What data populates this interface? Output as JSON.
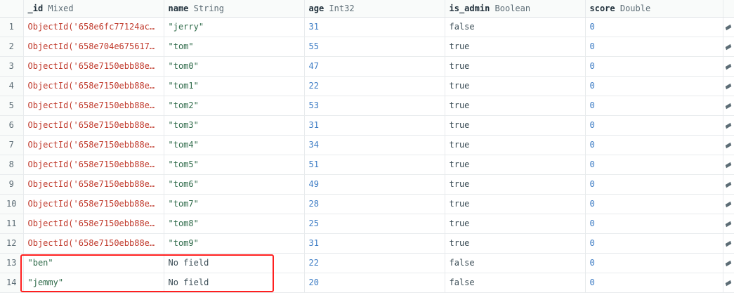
{
  "columns": [
    {
      "name": "_id",
      "type": "Mixed"
    },
    {
      "name": "name",
      "type": "String"
    },
    {
      "name": "age",
      "type": "Int32"
    },
    {
      "name": "is_admin",
      "type": "Boolean"
    },
    {
      "name": "score",
      "type": "Double"
    }
  ],
  "rows": [
    {
      "num": "1",
      "id": "ObjectId('658e6fc77124ac…",
      "id_kind": "oid",
      "name": "\"jerry\"",
      "name_kind": "str",
      "age": "31",
      "is_admin": "false",
      "score": "0"
    },
    {
      "num": "2",
      "id": "ObjectId('658e704e675617…",
      "id_kind": "oid",
      "name": "\"tom\"",
      "name_kind": "str",
      "age": "55",
      "is_admin": "true",
      "score": "0"
    },
    {
      "num": "3",
      "id": "ObjectId('658e7150ebb88e…",
      "id_kind": "oid",
      "name": "\"tom0\"",
      "name_kind": "str",
      "age": "47",
      "is_admin": "true",
      "score": "0"
    },
    {
      "num": "4",
      "id": "ObjectId('658e7150ebb88e…",
      "id_kind": "oid",
      "name": "\"tom1\"",
      "name_kind": "str",
      "age": "22",
      "is_admin": "true",
      "score": "0"
    },
    {
      "num": "5",
      "id": "ObjectId('658e7150ebb88e…",
      "id_kind": "oid",
      "name": "\"tom2\"",
      "name_kind": "str",
      "age": "53",
      "is_admin": "true",
      "score": "0"
    },
    {
      "num": "6",
      "id": "ObjectId('658e7150ebb88e…",
      "id_kind": "oid",
      "name": "\"tom3\"",
      "name_kind": "str",
      "age": "31",
      "is_admin": "true",
      "score": "0"
    },
    {
      "num": "7",
      "id": "ObjectId('658e7150ebb88e…",
      "id_kind": "oid",
      "name": "\"tom4\"",
      "name_kind": "str",
      "age": "34",
      "is_admin": "true",
      "score": "0"
    },
    {
      "num": "8",
      "id": "ObjectId('658e7150ebb88e…",
      "id_kind": "oid",
      "name": "\"tom5\"",
      "name_kind": "str",
      "age": "51",
      "is_admin": "true",
      "score": "0"
    },
    {
      "num": "9",
      "id": "ObjectId('658e7150ebb88e…",
      "id_kind": "oid",
      "name": "\"tom6\"",
      "name_kind": "str",
      "age": "49",
      "is_admin": "true",
      "score": "0"
    },
    {
      "num": "10",
      "id": "ObjectId('658e7150ebb88e…",
      "id_kind": "oid",
      "name": "\"tom7\"",
      "name_kind": "str",
      "age": "28",
      "is_admin": "true",
      "score": "0"
    },
    {
      "num": "11",
      "id": "ObjectId('658e7150ebb88e…",
      "id_kind": "oid",
      "name": "\"tom8\"",
      "name_kind": "str",
      "age": "25",
      "is_admin": "true",
      "score": "0"
    },
    {
      "num": "12",
      "id": "ObjectId('658e7150ebb88e…",
      "id_kind": "oid",
      "name": "\"tom9\"",
      "name_kind": "str",
      "age": "31",
      "is_admin": "true",
      "score": "0"
    },
    {
      "num": "13",
      "id": "\"ben\"",
      "id_kind": "str",
      "name": "No field",
      "name_kind": "missing",
      "age": "22",
      "is_admin": "false",
      "score": "0"
    },
    {
      "num": "14",
      "id": "\"jemmy\"",
      "id_kind": "str",
      "name": "No field",
      "name_kind": "missing",
      "age": "20",
      "is_admin": "false",
      "score": "0"
    }
  ],
  "colors": {
    "objectid": "#c0392b",
    "string": "#2f6b4a",
    "number": "#3b7bc4",
    "highlight": "#ff1f1f"
  },
  "icons": {
    "row_edit": "pencil-icon"
  }
}
